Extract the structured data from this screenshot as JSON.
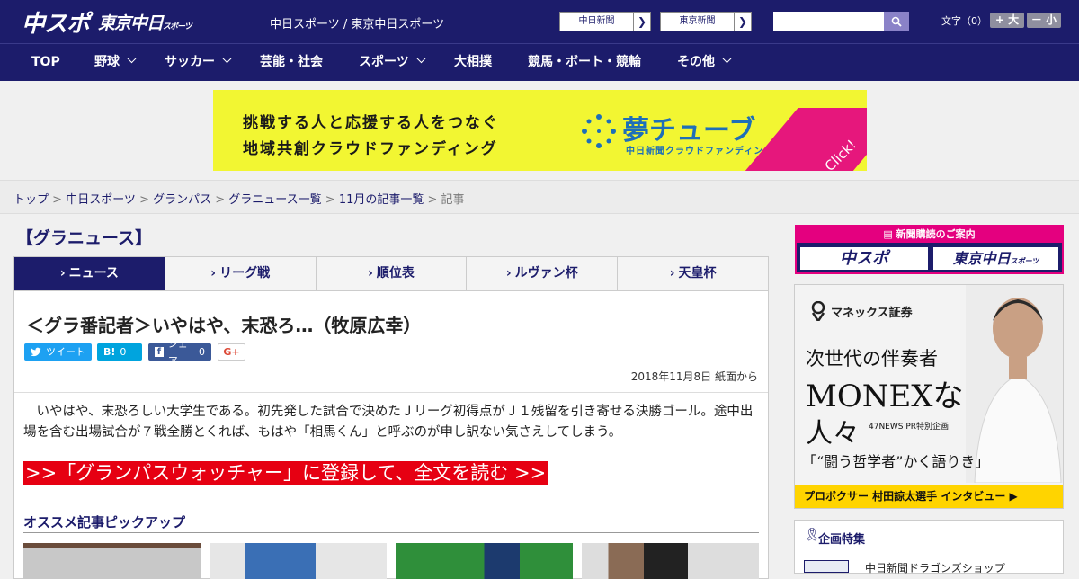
{
  "header": {
    "logo_main": "中スポ",
    "logo_sub": "東京中日",
    "logo_sub_small": "スポーツ",
    "site_title": "中日スポーツ / 東京中日スポーツ",
    "paper_links": [
      {
        "label": "中日新聞"
      },
      {
        "label": "東京新聞"
      }
    ],
    "search_placeholder": "",
    "font_size_label": "文字（0）",
    "font_larger": "+ 大",
    "font_smaller": "－ 小"
  },
  "nav": {
    "items": [
      {
        "label": "TOP",
        "dropdown": false
      },
      {
        "label": "野球",
        "dropdown": true
      },
      {
        "label": "サッカー",
        "dropdown": true
      },
      {
        "label": "芸能・社会",
        "dropdown": false
      },
      {
        "label": "スポーツ",
        "dropdown": true
      },
      {
        "label": "大相撲",
        "dropdown": false
      },
      {
        "label": "競馬・ボート・競輪",
        "dropdown": false
      },
      {
        "label": "その他",
        "dropdown": true
      }
    ]
  },
  "banner": {
    "line1": "挑戦する人と応援する人をつなぐ",
    "line2": "地域共創クラウドファンディング",
    "brand": "夢チューブ",
    "brand_sub": "中日新聞クラウドファンディング",
    "click": "Click!"
  },
  "breadcrumb": {
    "items": [
      "トップ",
      "中日スポーツ",
      "グランパス",
      "グラニュース一覧",
      "11月の記事一覧"
    ],
    "current": "記事",
    "sep": " > "
  },
  "category_title": "【グラニュース】",
  "tabs": [
    {
      "label": "ニュース",
      "active": true
    },
    {
      "label": "リーグ戦",
      "active": false
    },
    {
      "label": "順位表",
      "active": false
    },
    {
      "label": "ルヴァン杯",
      "active": false
    },
    {
      "label": "天皇杯",
      "active": false
    }
  ],
  "article": {
    "headline": "＜グラ番記者＞いやはや、末恐ろ…（牧原広幸）",
    "share": {
      "tweet": "ツイート",
      "hatena_label": "B!",
      "hatena_count": "0",
      "fb_label": "シェア",
      "fb_count": "0",
      "gplus": "G+"
    },
    "date": "2018年11月8日 紙面から",
    "body": "いやはや、末恐ろしい大学生である。初先発した試合で決めたＪリーグ初得点がＪ１残留を引き寄せる決勝ゴール。途中出場を含む出場試合が７戦全勝とくれば、もはや「相馬くん」と呼ぶのが申し訳ない気さえしてしまう。",
    "cta": ">>「グランパスウォッチャー」に登録して、全文を読む >>"
  },
  "pickup": {
    "title": "オススメ記事ピックアップ"
  },
  "sidebar": {
    "subscribe_head": "新聞購読のご案内",
    "subscribe_left": "中スポ",
    "subscribe_right": "東京中日",
    "subscribe_right_small": "スポーツ",
    "ad": {
      "logo": "マネックス証券",
      "t1": "次世代の伴奏者",
      "t2": "MONEXな",
      "t3": "人々",
      "pr": "47NEWS PR特別企画",
      "quote": "「“闘う哲学者”かく語りき」",
      "foot": "プロボクサー 村田諒太選手 インタビュー ▶"
    },
    "feature_title": "企画特集",
    "feature_item": "中日新聞ドラゴンズショップ"
  },
  "colors": {
    "navy": "#1c1c6b",
    "cta_red": "#e60012",
    "banner_yellow": "#f2f632",
    "pink": "#e4007f"
  }
}
